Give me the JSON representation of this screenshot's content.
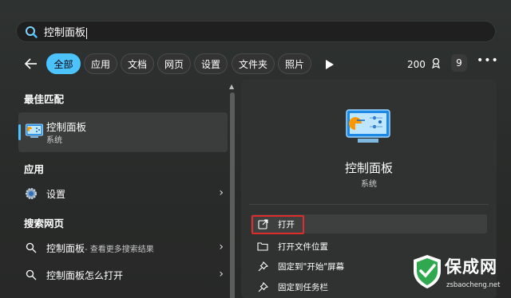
{
  "search": {
    "query": "控制面板"
  },
  "filters": {
    "chips": [
      "全部",
      "应用",
      "文档",
      "网页",
      "设置",
      "文件夹",
      "照片"
    ],
    "points": "200",
    "badge": "9",
    "more": "•••"
  },
  "left": {
    "best_match_heading": "最佳匹配",
    "best_match": {
      "title": "控制面板",
      "subtitle": "系统"
    },
    "apps_heading": "应用",
    "apps": [
      {
        "label": "设置"
      }
    ],
    "web_heading": "搜索网页",
    "web": [
      {
        "label": "控制面板",
        "suffix": " - 查看更多搜索结果"
      },
      {
        "label": "控制面板怎么打开",
        "suffix": ""
      }
    ]
  },
  "detail": {
    "title": "控制面板",
    "subtitle": "系统",
    "actions": [
      "打开",
      "打开文件位置",
      "固定到\"开始\"屏幕",
      "固定到任务栏"
    ]
  },
  "watermark": {
    "name": "保成网",
    "url": "zsbaocheng.net"
  },
  "colors": {
    "accent": "#4cc2ff",
    "highlight_box": "#e02b2b",
    "watermark_green": "#2fa84f"
  }
}
